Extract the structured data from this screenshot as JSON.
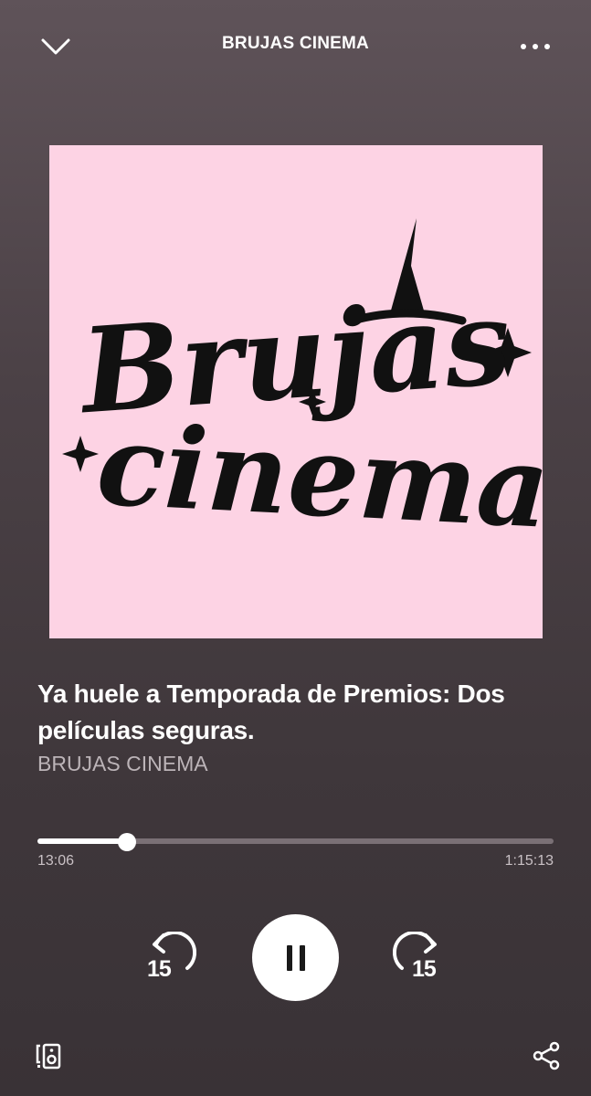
{
  "header": {
    "title": "BRUJAS CINEMA",
    "collapse_icon": "chevron-down-icon",
    "more_icon": "more-horizontal-icon"
  },
  "cover": {
    "logo_line1": "Brujas",
    "logo_line2": "cinema",
    "background": "#fdd3e4"
  },
  "episode": {
    "title": "Ya huele a Temporada de Premios: Dos películas seguras.",
    "show": "BRUJAS CINEMA"
  },
  "playback": {
    "elapsed": "13:06",
    "total": "1:15:13",
    "progress_fraction": 0.174,
    "state": "playing"
  },
  "controls": {
    "skip_back_label": "15",
    "skip_forward_label": "15",
    "skip_back_icon": "rewind-15-icon",
    "skip_forward_icon": "forward-15-icon",
    "play_pause_icon": "pause-icon"
  },
  "footer": {
    "devices_icon": "connect-device-icon",
    "share_icon": "share-icon"
  },
  "colors": {
    "background_top": "#5f5359",
    "background_bottom": "#393236",
    "accent": "#ffffff",
    "track": "#7a7075"
  }
}
